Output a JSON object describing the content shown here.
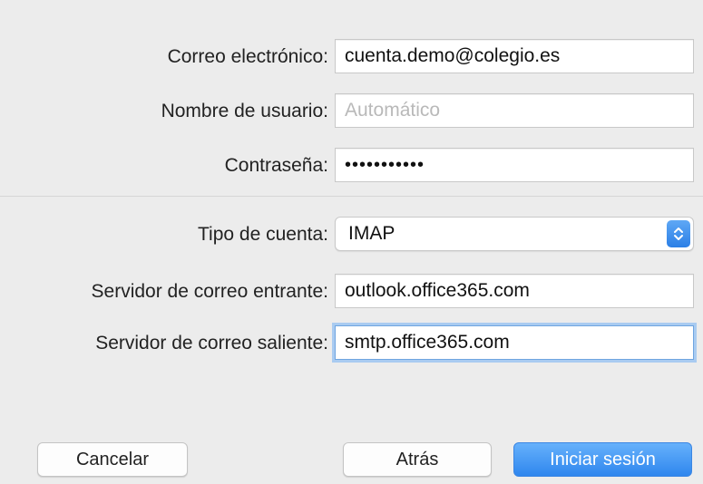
{
  "form": {
    "email_label": "Correo electrónico:",
    "email_value": "cuenta.demo@colegio.es",
    "username_label": "Nombre de usuario:",
    "username_placeholder": "Automático",
    "password_label": "Contraseña:",
    "password_masked": "•••••••••••",
    "account_type_label": "Tipo de cuenta:",
    "account_type_value": "IMAP",
    "incoming_label": "Servidor de correo entrante:",
    "incoming_value": "outlook.office365.com",
    "outgoing_label": "Servidor de correo saliente:",
    "outgoing_value": "smtp.office365.com"
  },
  "buttons": {
    "cancel": "Cancelar",
    "back": "Atrás",
    "sign_in": "Iniciar sesión"
  },
  "icons": {
    "select_arrows": "chevron-up-down-icon"
  },
  "colors": {
    "accent": "#2f86ee",
    "focus_ring": "#a9cbf1",
    "background": "#ececec"
  }
}
